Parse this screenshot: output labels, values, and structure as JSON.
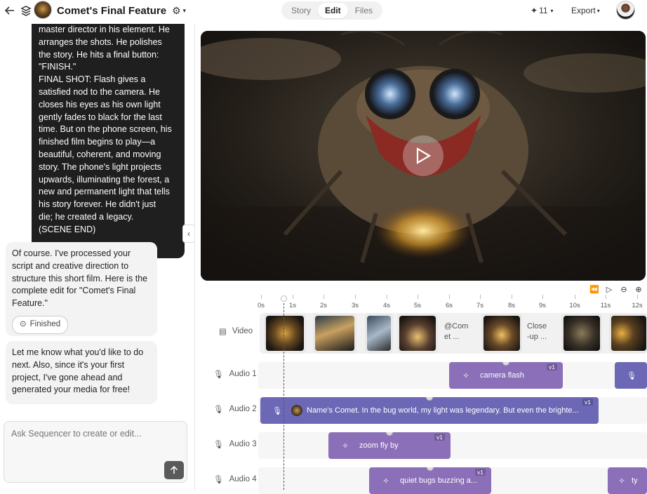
{
  "header": {
    "title": "Comet's Final Feature",
    "tabs": [
      {
        "label": "Story",
        "active": false
      },
      {
        "label": "Edit",
        "active": true
      },
      {
        "label": "Files",
        "active": false
      }
    ],
    "credits": "11",
    "export_label": "Export"
  },
  "chat": {
    "script_message": "master director in his element. He\narranges the shots. He polishes\nthe story. He hits a final button:\n\"FINISH.\"\nFINAL SHOT: Flash gives a\nsatisfied nod to the camera. He\ncloses his eyes as his own light\ngently fades to black for the last\ntime. But on the phone screen, his\nfinished film begins to play—a\nbeautiful, coherent, and moving\nstory. The phone's light projects\nupwards, illuminating the forest, a\nnew and permanent light that tells\nhis story forever. He didn't just\ndie; he created a legacy.\n(SCENE END)",
    "reply_1": "Of course. I've processed your script and creative direction to structure this short film. Here is the complete edit for \"Comet's Final Feature.\"",
    "status_chip": "Finished",
    "reply_2": "Let me know what you'd like to do next. Also, since it's your first project, I've gone ahead and generated your media for free!",
    "input_placeholder": "Ask Sequencer to create or edit..."
  },
  "timeline": {
    "ruler": [
      "0s",
      "1s",
      "2s",
      "3s",
      "4s",
      "5s",
      "6s",
      "7s",
      "8s",
      "9s",
      "10s",
      "11s",
      "12s"
    ],
    "tracks": {
      "video": "Video",
      "audio1": "Audio 1",
      "audio2": "Audio 2",
      "audio3": "Audio 3",
      "audio4": "Audio 4"
    },
    "video_clip_texts": [
      "@Com\net ...",
      "Close\n-up ..."
    ],
    "audio_clips": {
      "camera_flash": {
        "label": "camera flash",
        "version": "v1"
      },
      "narration": {
        "label": "Name's Comet. In the bug world, my light was legendary. But even the brighte...",
        "version": "v1"
      },
      "zoom": {
        "label": "zoom fly by",
        "version": "v1"
      },
      "quiet_bugs": {
        "label": "quiet bugs buzzing a...",
        "version": "v1"
      },
      "ty": {
        "label": "ty",
        "version": ""
      }
    }
  },
  "colors": {
    "clip_purple": "#8b6fb8",
    "clip_blue_purple": "#6d68b6",
    "dark_bubble": "#1f1f1f"
  }
}
